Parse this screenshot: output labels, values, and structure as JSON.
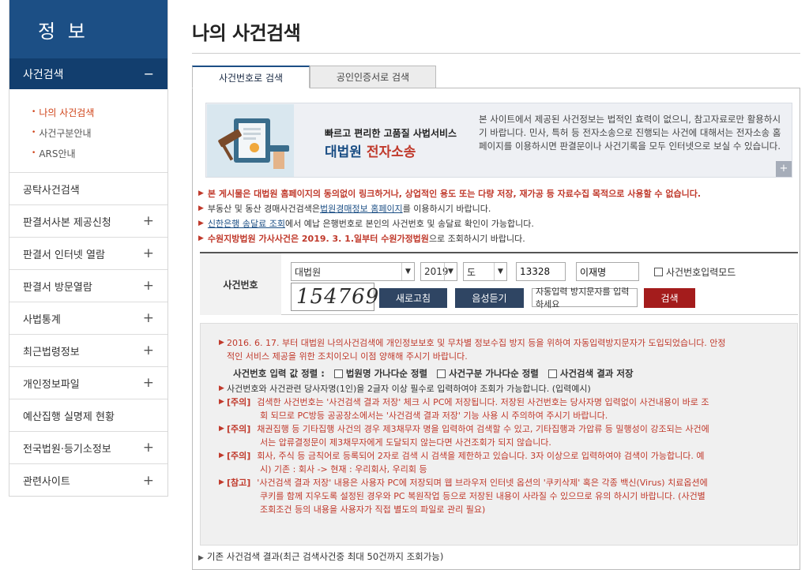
{
  "sidebar": {
    "title": "정 보",
    "section": {
      "label": "사건검색",
      "toggle": "−"
    },
    "links": [
      {
        "label": "나의 사건검색",
        "active": true
      },
      {
        "label": "사건구분안내",
        "active": false
      },
      {
        "label": "ARS안내",
        "active": false
      }
    ],
    "items": [
      {
        "label": "공탁사건검색",
        "toggle": ""
      },
      {
        "label": "판결서사본 제공신청",
        "toggle": "+"
      },
      {
        "label": "판결서 인터넷 열람",
        "toggle": "+"
      },
      {
        "label": "판결서 방문열람",
        "toggle": "+"
      },
      {
        "label": "사법통계",
        "toggle": "+"
      },
      {
        "label": "최근법령정보",
        "toggle": "+"
      },
      {
        "label": "개인정보파일",
        "toggle": "+"
      },
      {
        "label": "예산집행 실명제 현황",
        "toggle": ""
      },
      {
        "label": "전국법원·등기소정보",
        "toggle": "+"
      },
      {
        "label": "관련사이트",
        "toggle": "+"
      }
    ]
  },
  "page": {
    "title": "나의 사건검색"
  },
  "tabs": [
    {
      "label": "사건번호로 검색",
      "active": true
    },
    {
      "label": "공인인증서로 검색",
      "active": false
    }
  ],
  "banner": {
    "subtitle": "빠르고 편리한 고품질 사법서비스",
    "title_blue": "대법원",
    "title_red": "전자소송",
    "desc": "본 사이트에서 제공된 사건정보는 법적인 효력이 없으니, 참고자료로만 활용하시기 바랍니다. 민사, 특허 등 전자소송으로 진행되는 사건에 대해서는 전자소송 홈페이지를 이용하시면 판결문이나 사건기록을 모두 인터넷으로 보실 수 있습니다.",
    "more": "+"
  },
  "notices": {
    "n1": "본 게시물은 대법원 홈페이지의 동의없이 링크하거나, 상업적인 용도 또는 다량 저장, 재가공 등 자료수집 목적으로 사용할 수 없습니다.",
    "n2_pre": "부동산 및 동산 경매사건검색은 ",
    "n2_link": "법원경매정보 홈페이지",
    "n2_post": "를 이용하시기 바랍니다.",
    "n3_link": "신한은행 송달료 조회",
    "n3_post": "에서 예납 은행번호로 본인의 사건번호 및 송달료 확인이 가능합니다.",
    "n4_bold": "수원지방법원 가사사건은 2019. 3. 1.일부터 수원가정법원",
    "n4_post": "으로 조회하시기 바랍니다."
  },
  "search": {
    "label": "사건번호",
    "court": "대법원",
    "year": "2019",
    "type": "도",
    "number": "13328",
    "party": "이재명",
    "mode_label": "사건번호입력모드",
    "captcha_text": "154769",
    "refresh_label": "새로고침",
    "audio_label": "음성듣기",
    "captcha_placeholder": "자동입력 방지문자를 입력하세요",
    "submit_label": "검색"
  },
  "info": {
    "l1a": "2016. 6. 17. 부터 대법원 나의사건검색에 개인정보보호 및 무차별 정보수집 방지 등을 위하여 자동입력방지문자가 도입되었습니다. 안정",
    "l1b": "적인 서비스 제공을 위한 조치이오니 이점 양해해 주시기 바랍니다.",
    "sort_label": "사건번호 입력 값 정렬 :",
    "sort1": "법원명 가나다순 정렬",
    "sort2": "사건구분 가나다순 정렬",
    "sort3": "사건검색 결과 저장",
    "l2": "사건번호와 사건관련 당사자명(1인)을 2글자 이상 필수로 입력하여야 조회가 가능합니다. (입력예시)",
    "tag_note": "[주의]",
    "tag_ref": "[참고]",
    "l3a": "검색한 사건번호는 '사건검색 결과 저장' 체크 시 PC에 저장됩니다. 저장된 사건번호는 당사자명 입력없이 사건내용이 바로 조",
    "l3b": "회 되므로 PC방등 공공장소에서는 '사건검색 결과 저장' 기능 사용 시 주의하여 주시기 바랍니다.",
    "l4a": "채권집행 등 기타집행 사건의 경우 제3채무자 명을 입력하여 검색할 수 있고, 기타집행과 가압류 등 밀행성이 강조되는 사건에",
    "l4b": "서는 압류결정문이 제3채무자에게 도달되지 않는다면 사건조회가 되지 않습니다.",
    "l5a": "회사, 주식 등 금칙어로 등록되어 2자로 검색 시 검색을 제한하고 있습니다. 3자 이상으로 입력하여야 검색이 가능합니다. 예",
    "l5b": "시) 기존 : 회사 -> 현재 : 우리회사, 우리회 등",
    "l6a": "'사건검색 결과 저장' 내용은 사용자 PC에 저장되며 웹 브라우저 인터넷 옵션의 '쿠키삭제' 혹은 각종 백신(Virus) 치료옵션에",
    "l6b": "쿠키를 함께 지우도록 설정된 경우와 PC 복원작업 등으로 저장된 내용이 사라질 수 있으므로 유의 하시기 바랍니다. (사건별",
    "l6c": "조회조건 등의 내용을 사용자가 직접 별도의 파일로 관리 필요)"
  },
  "bottom": {
    "note": "기존 사건검색 결과(최근 검색사건중 최대 50건까지 조회가능)"
  },
  "colors": {
    "navy": "#1c4f85",
    "dark_navy": "#123e6e",
    "accent_red": "#c0392b"
  }
}
